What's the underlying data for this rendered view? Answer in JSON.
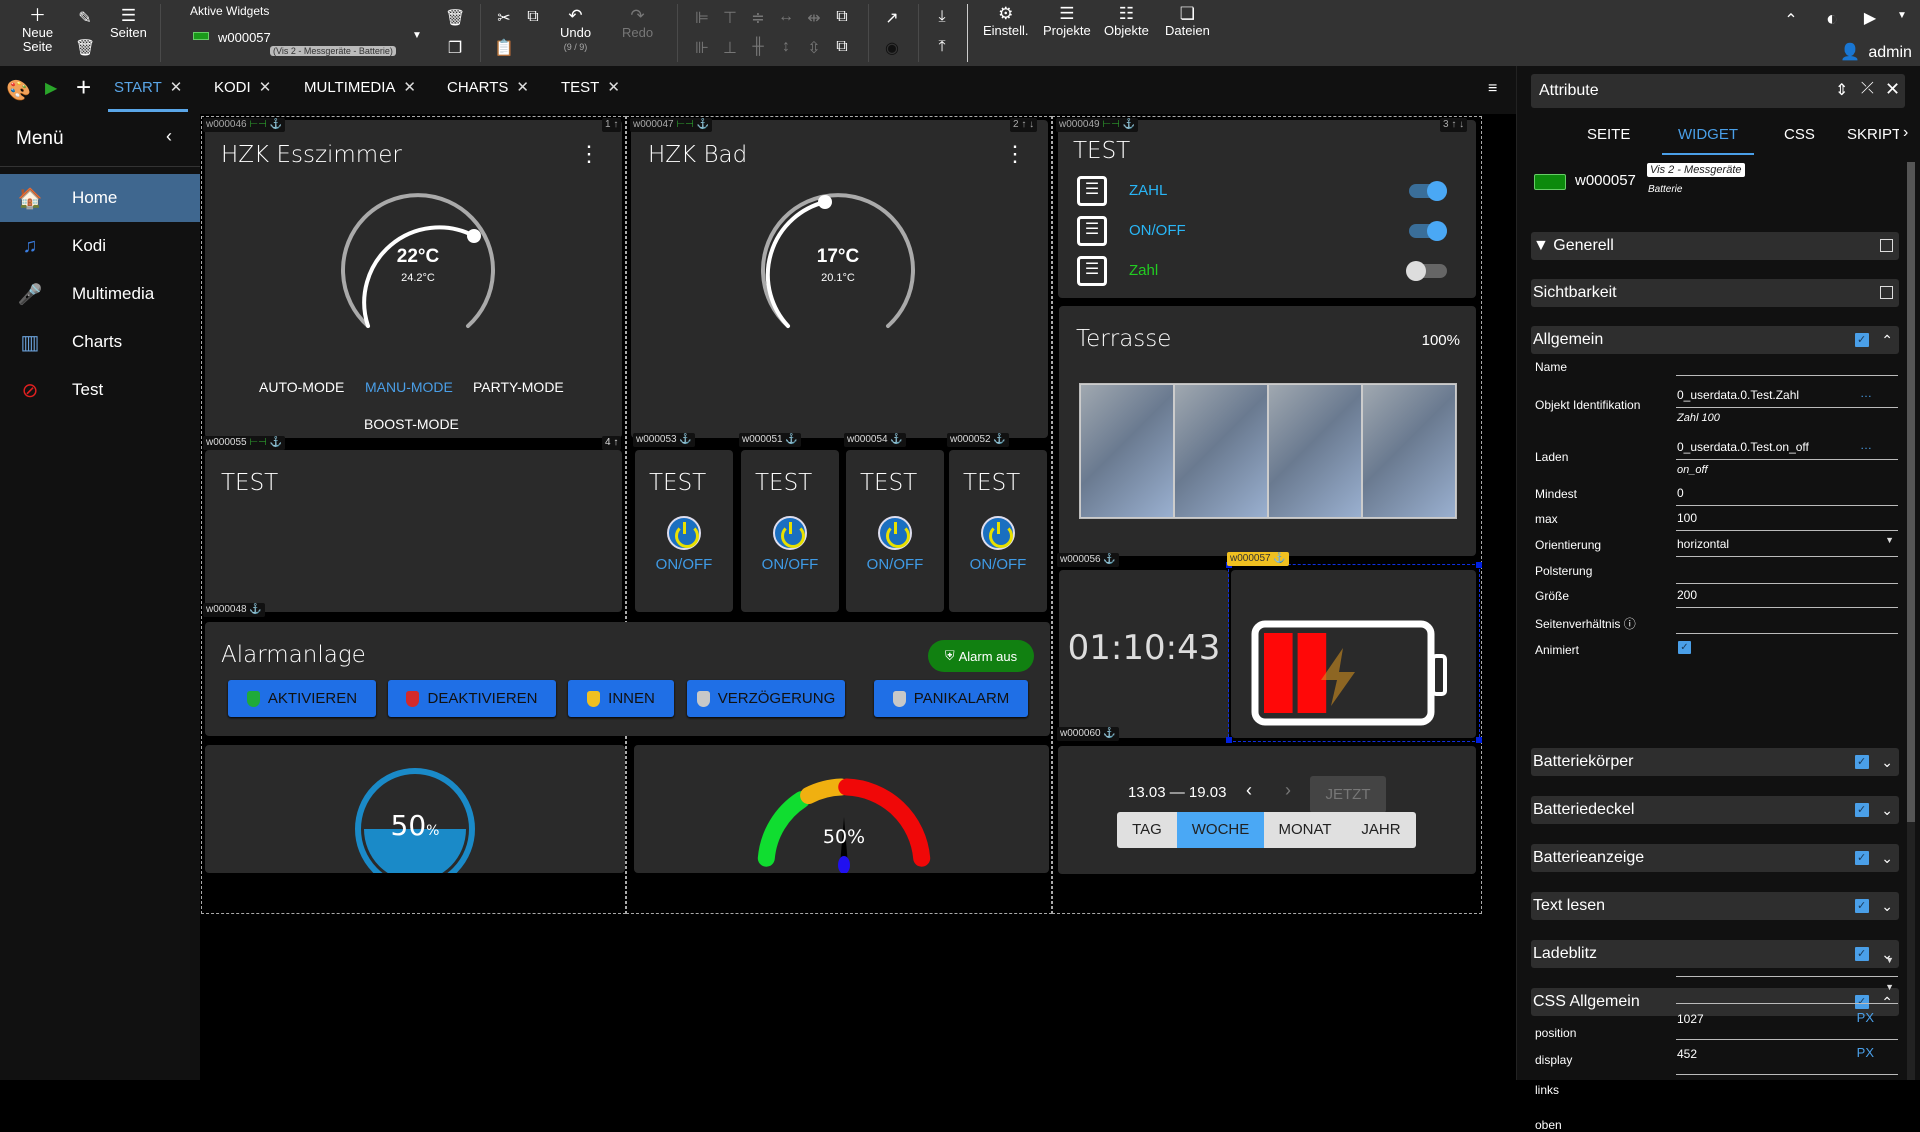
{
  "toolbar": {
    "new_page_line1": "Neue",
    "new_page_line2": "Seite",
    "pages_label": "Seiten",
    "active_widgets_label": "Aktive Widgets",
    "active_widget_id": "w000057",
    "active_widget_type": "(Vis 2 - Messgeräte - Batterie)",
    "undo_label": "Undo",
    "undo_count": "(9 / 9)",
    "redo_label": "Redo",
    "settings_label": "Einstell.",
    "projects_label": "Projekte",
    "objects_label": "Objekte",
    "files_label": "Dateien",
    "user_label": "admin"
  },
  "tabs": [
    {
      "label": "START",
      "active": true
    },
    {
      "label": "KODI"
    },
    {
      "label": "MULTIMEDIA"
    },
    {
      "label": "CHARTS"
    },
    {
      "label": "TEST"
    }
  ],
  "sidebar": {
    "title": "Menü",
    "items": [
      {
        "label": "Home",
        "icon": "house-icon",
        "active": true
      },
      {
        "label": "Kodi",
        "icon": "music-note-icon"
      },
      {
        "label": "Multimedia",
        "icon": "microphone-icon"
      },
      {
        "label": "Charts",
        "icon": "bar-chart-icon"
      },
      {
        "label": "Test",
        "icon": "prohibited-icon"
      }
    ]
  },
  "widgets": {
    "hzk_esszimmer": {
      "id": "w000046",
      "title": "HZK Esszimmer",
      "setpoint": "22°C",
      "actual": "24.2°C",
      "order": "1",
      "modes": [
        "AUTO-MODE",
        "MANU-MODE",
        "PARTY-MODE",
        "BOOST-MODE"
      ],
      "active_mode": "MANU-MODE"
    },
    "hzk_bad": {
      "id": "w000047",
      "title": "HZK Bad",
      "setpoint": "17°C",
      "actual": "20.1°C",
      "order": "2"
    },
    "test_list": {
      "id": "w000049",
      "title": "TEST",
      "order": "3",
      "items": [
        {
          "label": "ZAHL",
          "on": true,
          "color": "#29b6f6"
        },
        {
          "label": "ON/OFF",
          "on": true,
          "color": "#29b6f6"
        },
        {
          "label": "Zahl",
          "on": false,
          "color": "#22cc22"
        }
      ]
    },
    "test_empty": {
      "id": "w000055",
      "title": "TEST",
      "order": "4",
      "bottom_id": "w000048"
    },
    "switches": [
      {
        "id": "w000053",
        "title": "TEST",
        "label": "ON/OFF"
      },
      {
        "id": "w000051",
        "title": "TEST",
        "label": "ON/OFF"
      },
      {
        "id": "w000054",
        "title": "TEST",
        "label": "ON/OFF"
      },
      {
        "id": "w000052",
        "title": "TEST",
        "label": "ON/OFF"
      }
    ],
    "terrasse": {
      "title": "Terrasse",
      "value": "100%"
    },
    "clock": {
      "id": "w000056",
      "time": "01:10:43",
      "bottom_id": "w000060"
    },
    "battery": {
      "id": "w000057",
      "level_percent": 40,
      "charging": true
    },
    "alarm": {
      "title": "Alarmanlage",
      "status": "Alarm aus",
      "buttons": [
        {
          "label": "AKTIVIEREN",
          "shield": "#1faa3a"
        },
        {
          "label": "DEAKTIVIEREN",
          "shield": "#d42a2a"
        },
        {
          "label": "INNEN",
          "shield": "#f0c020"
        },
        {
          "label": "VERZÖGERUNG",
          "shield": "#c8c8c8"
        },
        {
          "label": "PANIKALARM",
          "shield": "#c8c8c8"
        }
      ]
    },
    "tank": {
      "value": "50",
      "unit": "%",
      "fill_percent": 50
    },
    "gauge": {
      "value": "50%",
      "fill_percent": 50
    },
    "date_range": {
      "range": "13.03 — 19.03",
      "now_label": "JETZT",
      "periods": [
        "TAG",
        "WOCHE",
        "MONAT",
        "JAHR"
      ],
      "active_period": "WOCHE"
    }
  },
  "attributes": {
    "title": "Attribute",
    "tabs": [
      "SEITE",
      "WIDGET",
      "CSS",
      "SKRIPTE"
    ],
    "active_tab": "WIDGET",
    "widget_id": "w000057",
    "widget_set": "Vis 2 - Messgeräte",
    "widget_name": "Batterie",
    "sections": {
      "generell": "Generell",
      "sichtbarkeit": "Sichtbarkeit",
      "allgemein": "Allgemein",
      "batteriekoerper": "Batteriekörper",
      "batteriedeckel": "Batteriedeckel",
      "batterieanzeige": "Batterieanzeige",
      "text_lesen": "Text lesen",
      "ladeblitz": "Ladeblitz",
      "css_allgemein": "CSS Allgemein"
    },
    "fields": {
      "name": {
        "label": "Name",
        "value": ""
      },
      "oid": {
        "label": "Objekt Identifikation",
        "value": "0_userdata.0.Test.Zahl",
        "sub": "Zahl 100"
      },
      "laden": {
        "label": "Laden",
        "value": "0_userdata.0.Test.on_off",
        "sub": "on_off"
      },
      "mindest": {
        "label": "Mindest",
        "value": "0"
      },
      "max": {
        "label": "max",
        "value": "100"
      },
      "orientierung": {
        "label": "Orientierung",
        "value": "horizontal"
      },
      "polsterung": {
        "label": "Polsterung",
        "value": ""
      },
      "groesse": {
        "label": "Größe",
        "value": "200"
      },
      "seitenverhaeltnis": {
        "label": "Seitenverhältnis",
        "value": ""
      },
      "animiert": {
        "label": "Animiert",
        "checked": true
      },
      "position": {
        "label": "position",
        "value": ""
      },
      "display": {
        "label": "display",
        "value": ""
      },
      "links": {
        "label": "links",
        "value": "1027",
        "unit": "PX"
      },
      "oben": {
        "label": "oben",
        "value": "452",
        "unit": "PX"
      }
    }
  }
}
